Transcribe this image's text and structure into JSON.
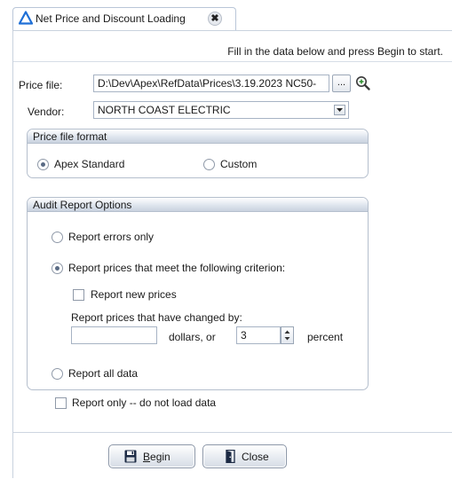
{
  "tab": {
    "title": "Net Price and Discount Loading",
    "close_glyph": "✖"
  },
  "instruction": "Fill in the data below and press Begin to start.",
  "price_file": {
    "label": "Price file:",
    "value": "D:\\Dev\\Apex\\RefData\\Prices\\3.19.2023 NC50-",
    "browse_label": "..."
  },
  "vendor": {
    "label": "Vendor:",
    "value": "NORTH COAST ELECTRIC"
  },
  "format_group": {
    "title": "Price file format",
    "options": [
      {
        "label": "Apex Standard",
        "checked": true
      },
      {
        "label": "Custom",
        "checked": false
      }
    ]
  },
  "audit_group": {
    "title": "Audit Report Options",
    "errors_only": "Report errors only",
    "criterion": "Report prices that meet the following criterion:",
    "new_prices": "Report new prices",
    "changed_by": "Report prices that have changed by:",
    "dollars_value": "",
    "dollars_suffix": "dollars, or",
    "percent_value": "3",
    "percent_suffix": "percent",
    "all_data": "Report all data",
    "selected_option": "criterion"
  },
  "report_only": "Report only -- do not load data",
  "buttons": {
    "begin": "Begin",
    "close": "Close"
  },
  "colors": {
    "accent": "#1f6fd6",
    "group_header": "#dfe5ee",
    "border": "#b5bfcd"
  },
  "icons": [
    "delta-triangle-icon",
    "close-tab-icon",
    "magnifier-icon",
    "dropdown-arrow-icon",
    "floppy-disk-icon",
    "door-exit-icon"
  ]
}
